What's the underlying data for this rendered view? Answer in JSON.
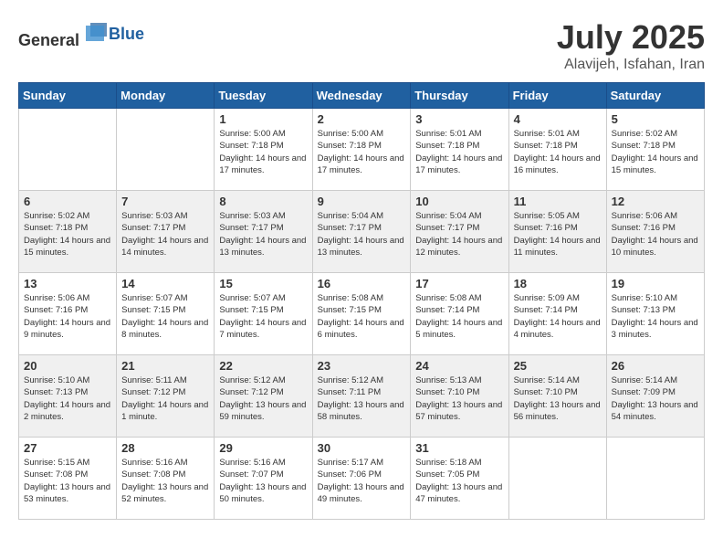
{
  "header": {
    "logo_general": "General",
    "logo_blue": "Blue",
    "month_year": "July 2025",
    "location": "Alavijeh, Isfahan, Iran"
  },
  "weekdays": [
    "Sunday",
    "Monday",
    "Tuesday",
    "Wednesday",
    "Thursday",
    "Friday",
    "Saturday"
  ],
  "weeks": [
    [
      {
        "day": "",
        "sunrise": "",
        "sunset": "",
        "daylight": ""
      },
      {
        "day": "",
        "sunrise": "",
        "sunset": "",
        "daylight": ""
      },
      {
        "day": "1",
        "sunrise": "Sunrise: 5:00 AM",
        "sunset": "Sunset: 7:18 PM",
        "daylight": "Daylight: 14 hours and 17 minutes."
      },
      {
        "day": "2",
        "sunrise": "Sunrise: 5:00 AM",
        "sunset": "Sunset: 7:18 PM",
        "daylight": "Daylight: 14 hours and 17 minutes."
      },
      {
        "day": "3",
        "sunrise": "Sunrise: 5:01 AM",
        "sunset": "Sunset: 7:18 PM",
        "daylight": "Daylight: 14 hours and 17 minutes."
      },
      {
        "day": "4",
        "sunrise": "Sunrise: 5:01 AM",
        "sunset": "Sunset: 7:18 PM",
        "daylight": "Daylight: 14 hours and 16 minutes."
      },
      {
        "day": "5",
        "sunrise": "Sunrise: 5:02 AM",
        "sunset": "Sunset: 7:18 PM",
        "daylight": "Daylight: 14 hours and 15 minutes."
      }
    ],
    [
      {
        "day": "6",
        "sunrise": "Sunrise: 5:02 AM",
        "sunset": "Sunset: 7:18 PM",
        "daylight": "Daylight: 14 hours and 15 minutes."
      },
      {
        "day": "7",
        "sunrise": "Sunrise: 5:03 AM",
        "sunset": "Sunset: 7:17 PM",
        "daylight": "Daylight: 14 hours and 14 minutes."
      },
      {
        "day": "8",
        "sunrise": "Sunrise: 5:03 AM",
        "sunset": "Sunset: 7:17 PM",
        "daylight": "Daylight: 14 hours and 13 minutes."
      },
      {
        "day": "9",
        "sunrise": "Sunrise: 5:04 AM",
        "sunset": "Sunset: 7:17 PM",
        "daylight": "Daylight: 14 hours and 13 minutes."
      },
      {
        "day": "10",
        "sunrise": "Sunrise: 5:04 AM",
        "sunset": "Sunset: 7:17 PM",
        "daylight": "Daylight: 14 hours and 12 minutes."
      },
      {
        "day": "11",
        "sunrise": "Sunrise: 5:05 AM",
        "sunset": "Sunset: 7:16 PM",
        "daylight": "Daylight: 14 hours and 11 minutes."
      },
      {
        "day": "12",
        "sunrise": "Sunrise: 5:06 AM",
        "sunset": "Sunset: 7:16 PM",
        "daylight": "Daylight: 14 hours and 10 minutes."
      }
    ],
    [
      {
        "day": "13",
        "sunrise": "Sunrise: 5:06 AM",
        "sunset": "Sunset: 7:16 PM",
        "daylight": "Daylight: 14 hours and 9 minutes."
      },
      {
        "day": "14",
        "sunrise": "Sunrise: 5:07 AM",
        "sunset": "Sunset: 7:15 PM",
        "daylight": "Daylight: 14 hours and 8 minutes."
      },
      {
        "day": "15",
        "sunrise": "Sunrise: 5:07 AM",
        "sunset": "Sunset: 7:15 PM",
        "daylight": "Daylight: 14 hours and 7 minutes."
      },
      {
        "day": "16",
        "sunrise": "Sunrise: 5:08 AM",
        "sunset": "Sunset: 7:15 PM",
        "daylight": "Daylight: 14 hours and 6 minutes."
      },
      {
        "day": "17",
        "sunrise": "Sunrise: 5:08 AM",
        "sunset": "Sunset: 7:14 PM",
        "daylight": "Daylight: 14 hours and 5 minutes."
      },
      {
        "day": "18",
        "sunrise": "Sunrise: 5:09 AM",
        "sunset": "Sunset: 7:14 PM",
        "daylight": "Daylight: 14 hours and 4 minutes."
      },
      {
        "day": "19",
        "sunrise": "Sunrise: 5:10 AM",
        "sunset": "Sunset: 7:13 PM",
        "daylight": "Daylight: 14 hours and 3 minutes."
      }
    ],
    [
      {
        "day": "20",
        "sunrise": "Sunrise: 5:10 AM",
        "sunset": "Sunset: 7:13 PM",
        "daylight": "Daylight: 14 hours and 2 minutes."
      },
      {
        "day": "21",
        "sunrise": "Sunrise: 5:11 AM",
        "sunset": "Sunset: 7:12 PM",
        "daylight": "Daylight: 14 hours and 1 minute."
      },
      {
        "day": "22",
        "sunrise": "Sunrise: 5:12 AM",
        "sunset": "Sunset: 7:12 PM",
        "daylight": "Daylight: 13 hours and 59 minutes."
      },
      {
        "day": "23",
        "sunrise": "Sunrise: 5:12 AM",
        "sunset": "Sunset: 7:11 PM",
        "daylight": "Daylight: 13 hours and 58 minutes."
      },
      {
        "day": "24",
        "sunrise": "Sunrise: 5:13 AM",
        "sunset": "Sunset: 7:10 PM",
        "daylight": "Daylight: 13 hours and 57 minutes."
      },
      {
        "day": "25",
        "sunrise": "Sunrise: 5:14 AM",
        "sunset": "Sunset: 7:10 PM",
        "daylight": "Daylight: 13 hours and 56 minutes."
      },
      {
        "day": "26",
        "sunrise": "Sunrise: 5:14 AM",
        "sunset": "Sunset: 7:09 PM",
        "daylight": "Daylight: 13 hours and 54 minutes."
      }
    ],
    [
      {
        "day": "27",
        "sunrise": "Sunrise: 5:15 AM",
        "sunset": "Sunset: 7:08 PM",
        "daylight": "Daylight: 13 hours and 53 minutes."
      },
      {
        "day": "28",
        "sunrise": "Sunrise: 5:16 AM",
        "sunset": "Sunset: 7:08 PM",
        "daylight": "Daylight: 13 hours and 52 minutes."
      },
      {
        "day": "29",
        "sunrise": "Sunrise: 5:16 AM",
        "sunset": "Sunset: 7:07 PM",
        "daylight": "Daylight: 13 hours and 50 minutes."
      },
      {
        "day": "30",
        "sunrise": "Sunrise: 5:17 AM",
        "sunset": "Sunset: 7:06 PM",
        "daylight": "Daylight: 13 hours and 49 minutes."
      },
      {
        "day": "31",
        "sunrise": "Sunrise: 5:18 AM",
        "sunset": "Sunset: 7:05 PM",
        "daylight": "Daylight: 13 hours and 47 minutes."
      },
      {
        "day": "",
        "sunrise": "",
        "sunset": "",
        "daylight": ""
      },
      {
        "day": "",
        "sunrise": "",
        "sunset": "",
        "daylight": ""
      }
    ]
  ]
}
